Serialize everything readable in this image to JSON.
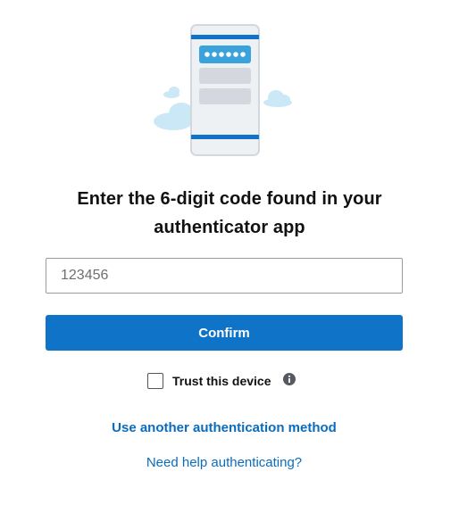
{
  "illustration": {
    "icon": "phone-authenticator-illustration",
    "code_dots": "●●●●●●",
    "colors": {
      "blue": "#0f74c8",
      "light_blue": "#3aa3db",
      "cloud": "#cbe8f6",
      "phone_body": "#eef1f4",
      "phone_line": "#d3d8de",
      "gray_block": "#d4d8de"
    }
  },
  "heading": {
    "title": "Enter the 6-digit code found in your authenticator app"
  },
  "form": {
    "code_placeholder": "123456",
    "code_value": "",
    "confirm_label": "Confirm",
    "trust_label": "Trust this device",
    "trust_checked": false,
    "info_icon": "info-icon"
  },
  "links": {
    "alt_method": "Use another authentication method",
    "help": "Need help authenticating?"
  },
  "colors": {
    "accent": "#0f74c8",
    "link": "#0a6cbd",
    "text": "#111111"
  }
}
